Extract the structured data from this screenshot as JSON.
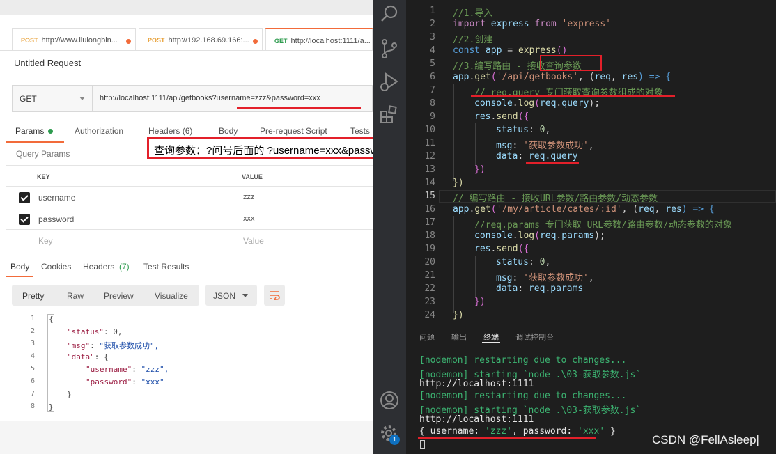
{
  "postman": {
    "tabs": [
      {
        "method": "POST",
        "url": "http://www.liulongbin..."
      },
      {
        "method": "POST",
        "url": "http://192.168.69.166:..."
      },
      {
        "method": "GET",
        "url": "http://localhost:1111/a..."
      }
    ],
    "request_title": "Untitled Request",
    "method": "GET",
    "url": "http://localhost:1111/api/getbooks?username=zzz&password=xxx",
    "req_tabs": [
      "Params",
      "Authorization",
      "Headers (6)",
      "Body",
      "Pre-request Script",
      "Tests"
    ],
    "query_params_label": "Query Params",
    "table_headers": {
      "key": "KEY",
      "value": "VALUE"
    },
    "params": [
      {
        "key": "username",
        "value": "zzz"
      },
      {
        "key": "password",
        "value": "xxx"
      }
    ],
    "placeholder": {
      "key": "Key",
      "value": "Value"
    },
    "resp_tabs": [
      "Body",
      "Cookies",
      "Headers",
      "(7)",
      "Test Results"
    ],
    "view_buttons": [
      "Pretty",
      "Raw",
      "Preview",
      "Visualize"
    ],
    "format": "JSON",
    "json_lines": [
      {
        "n": "1",
        "t": "{"
      },
      {
        "n": "2",
        "k": "\"status\"",
        "v": " 0,"
      },
      {
        "n": "3",
        "k": "\"msg\"",
        "v": " \"获取参数成功\","
      },
      {
        "n": "4",
        "k": "\"data\"",
        "v": " {"
      },
      {
        "n": "5",
        "k": "\"username\"",
        "v": " \"zzz\","
      },
      {
        "n": "6",
        "k": "\"password\"",
        "v": " \"xxx\""
      },
      {
        "n": "7",
        "t": "}"
      },
      {
        "n": "8",
        "t": "}"
      }
    ]
  },
  "annotation": "查询参数：?问号后面的 ?username=xxx&password = xxx",
  "editor": {
    "line_numbers": [
      "1",
      "2",
      "3",
      "4",
      "5",
      "6",
      "7",
      "8",
      "9",
      "10",
      "11",
      "12",
      "13",
      "14",
      "15",
      "16",
      "17",
      "18",
      "19",
      "20",
      "21",
      "22",
      "23",
      "24"
    ],
    "code": {
      "l1": "//1.导入",
      "l2a": "import",
      "l2b": " express ",
      "l2c": "from",
      "l2d": " 'express'",
      "l3": "//2.创建",
      "l4a": "const",
      "l4b": " app ",
      "l4c": "= ",
      "l4d": "express",
      "l4e": "()",
      "l5a": "//3.编写路由 - 接收",
      "l5b": "查询参数",
      "l6a": "app",
      "l6b": ".",
      "l6c": "get",
      "l6d": "(",
      "l6e": "'/api/getbooks'",
      "l6f": ", (",
      "l6g": "req",
      "l6h": ", ",
      "l6i": "res",
      "l6j": ") => {",
      "l7": "// req.query 专门获取查询参数组成的对象",
      "l8a": "console",
      "l8b": ".",
      "l8c": "log",
      "l8d": "(",
      "l8e": "req",
      "l8f": ".",
      "l8g": "query",
      "l8h": ");",
      "l9a": "res",
      "l9b": ".",
      "l9c": "send",
      "l9d": "({",
      "l10a": "status",
      "l10b": ": ",
      "l10c": "0",
      "l10d": ",",
      "l11a": "msg",
      "l11b": ": ",
      "l11c": "'获取参数成功'",
      "l11d": ",",
      "l12a": "data",
      "l12b": ": ",
      "l12c": "req.query",
      "l13": "})",
      "l14": "})",
      "l15": "// 编写路由 - 接收URL参数/路由参数/动态参数",
      "l16a": "app",
      "l16b": ".",
      "l16c": "get",
      "l16d": "(",
      "l16e": "'/my/article/cates/:id'",
      "l16f": ", (",
      "l16g": "req",
      "l16h": ", ",
      "l16i": "res",
      "l16j": ") => {",
      "l17": "//req.params 专门获取 URL参数/路由参数/动态参数的对象",
      "l18a": "console",
      "l18b": ".",
      "l18c": "log",
      "l18d": "(",
      "l18e": "req",
      "l18f": ".",
      "l18g": "params",
      "l18h": ");",
      "l19a": "res",
      "l19b": ".",
      "l19c": "send",
      "l19d": "({",
      "l20a": "status",
      "l20b": ": ",
      "l20c": "0",
      "l20d": ",",
      "l21a": "msg",
      "l21b": ": ",
      "l21c": "'获取参数成功'",
      "l21d": ",",
      "l22a": "data",
      "l22b": ": ",
      "l22c": "req",
      "l22d": ".",
      "l22e": "params",
      "l23": "})",
      "l24": "})"
    }
  },
  "panel": {
    "tabs": [
      "问题",
      "输出",
      "终端",
      "调试控制台"
    ],
    "lines": [
      "[nodemon] restarting due to changes...",
      "[nodemon] starting `node .\\03-获取参数.js`",
      "http://localhost:1111",
      "[nodemon] restarting due to changes...",
      "[nodemon] starting `node .\\03-获取参数.js`",
      "http://localhost:1111"
    ],
    "last": {
      "a": "{ ",
      "b": "username",
      "c": ": ",
      "d": "'zzz'",
      "e": ", ",
      "f": "password",
      "g": ": ",
      "h": "'xxx'",
      "i": " }"
    }
  },
  "badge": "1",
  "watermark": "CSDN @FellAsleep|"
}
